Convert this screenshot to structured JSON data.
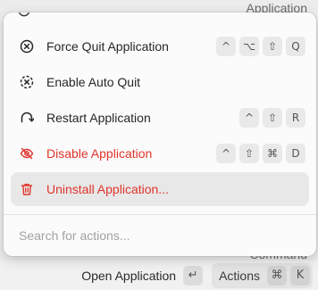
{
  "background": {
    "top_label": "Application",
    "command_label": "Command"
  },
  "bottom_bar": {
    "primary_action": "Open Application",
    "primary_key": "↵",
    "actions_label": "Actions",
    "actions_keys": [
      "⌘",
      "K"
    ]
  },
  "menu": {
    "items": [
      {
        "label": "Force Quit Application",
        "icon": "x-circle-icon",
        "shortcut": [
          "^",
          "⌥",
          "⇧",
          "Q"
        ],
        "danger": false,
        "selected": false
      },
      {
        "label": "Enable Auto Quit",
        "icon": "x-circle-dashed-icon",
        "shortcut": [],
        "danger": false,
        "selected": false
      },
      {
        "label": "Restart Application",
        "icon": "restart-arrow-icon",
        "shortcut": [
          "^",
          "⇧",
          "R"
        ],
        "danger": false,
        "selected": false
      },
      {
        "label": "Disable Application",
        "icon": "eye-off-icon",
        "shortcut": [
          "^",
          "⇧",
          "⌘",
          "D"
        ],
        "danger": true,
        "selected": false
      },
      {
        "label": "Uninstall Application...",
        "icon": "trash-icon",
        "shortcut": [],
        "danger": true,
        "selected": true
      }
    ],
    "search_placeholder": "Search for actions..."
  },
  "colors": {
    "danger": "#e0342b",
    "selected_bg": "#e8e8e8",
    "key_bg": "#e9e9e9"
  }
}
